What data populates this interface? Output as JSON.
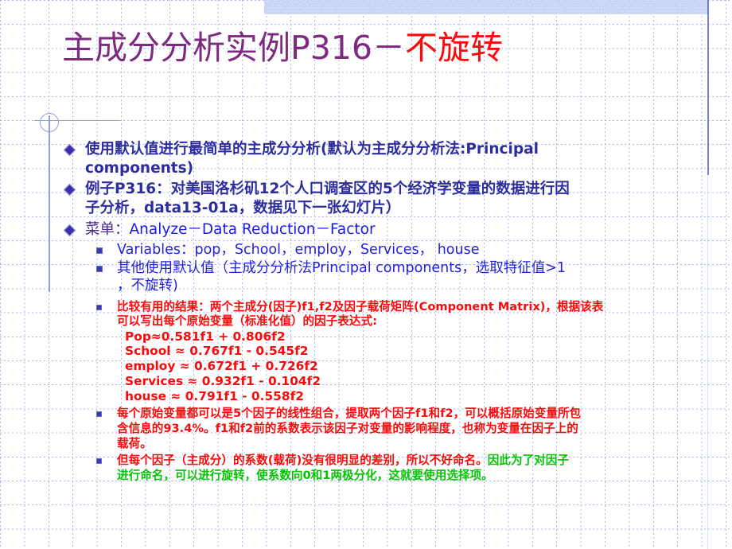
{
  "slide": {
    "title_main": "主成分分析实例P316－",
    "title_accent": "不旋转"
  },
  "bullets": {
    "b1": {
      "text_a": "使用默认值进行最简单的主成分分析(默认为主成分分析法:Principal ",
      "text_b": "components)"
    },
    "b2": {
      "text_a": "例子P316：对美国洛杉矶12个人口调查区的5个经济学变量的数据进行因",
      "text_b": "子分析，data13-01a，数据见下一张幻灯片）"
    },
    "b3": {
      "label": "菜单：",
      "value": "Analyze－Data Reduction－Factor"
    },
    "s1": "Variables：pop，School，employ，Services， house",
    "s2_a": "其他使用默认值（主成分分析法Principal components，选取特征值>1",
    "s2_b": "，不旋转)",
    "s3_line1": "比较有用的结果：两个主成分(因子)f1,f2及因子载荷矩阵(Component  Matrix)，根据该表",
    "s3_line2": "可以写出每个原始变量（标准化值）的因子表达式:",
    "s4_line1": "每个原始变量都可以是5个因子的线性组合，提取两个因子f1和f2，可以概括原始变量所包",
    "s4_line2": "含信息的93.4%。f1和f2前的系数表示该因子对变量的影响程度，也称为变量在因子上的",
    "s4_line3": "载荷。",
    "s5_red_1": "但每个因子（主成分）的系数(载荷)没有很明显的差别，所以不好命名。",
    "s5_green_1": "因此为了对因子",
    "s5_green_2": "进行命名，可以进行旋转，使系数向0和1两极分化，这就要使用选择项。"
  },
  "formulas": {
    "f1": "Pop≈0.581f1 + 0.806f2",
    "f2": "School ≈ 0.767f1 - 0.545f2",
    "f3": "employ ≈ 0.672f1 + 0.726f2",
    "f4": "Services ≈ 0.932f1 - 0.104f2",
    "f5": "house ≈ 0.791f1 - 0.558f2"
  },
  "colors": {
    "title_main": "#7d2a80",
    "title_accent": "#fa0a0a",
    "bullet_navy": "#2d2d9e",
    "bullet_blue": "#1a1aee",
    "red": "#fa0a0a",
    "green": "#04c404",
    "grid": "#9aacea",
    "accent_rule": "#5a6fd0"
  },
  "icons": {
    "bullet_diamond": "diamond-bullet-icon",
    "bullet_square": "square-bullet-icon",
    "deco_circle": "decorative-circle-icon"
  }
}
